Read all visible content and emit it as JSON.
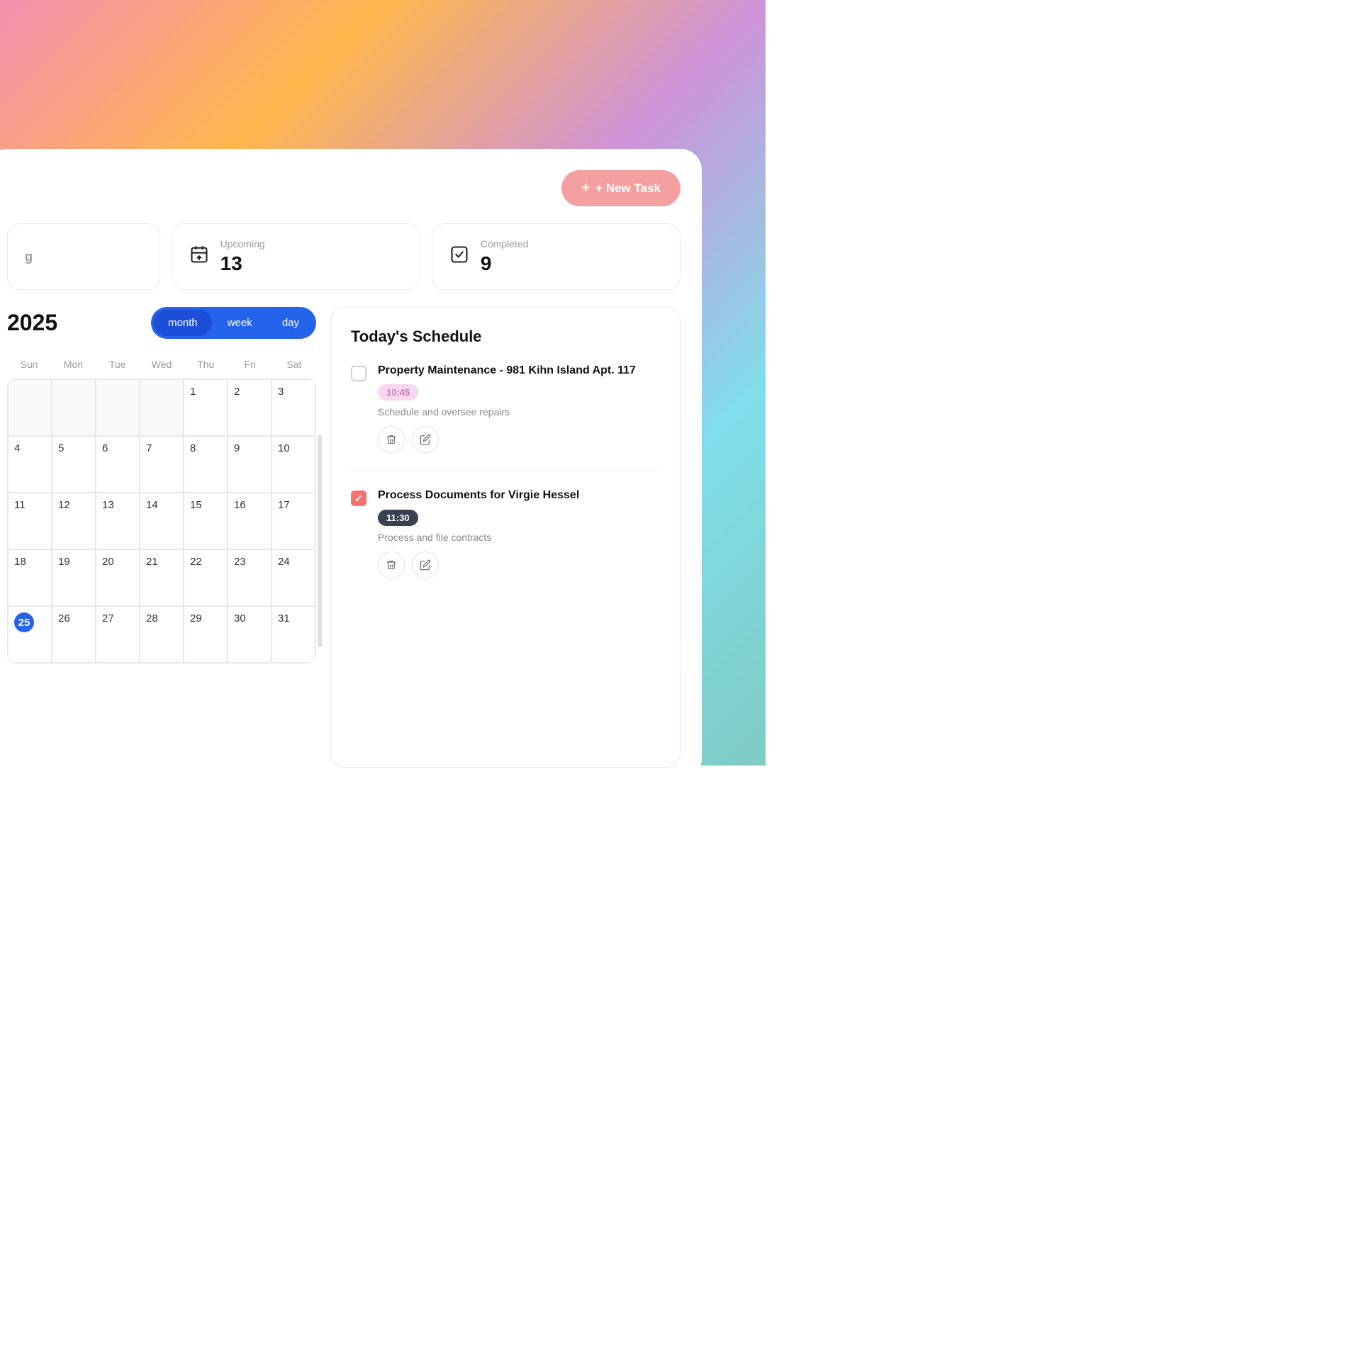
{
  "background": {
    "gradient": "pink to teal"
  },
  "header": {
    "new_task_label": "+ New Task"
  },
  "stats": {
    "partial_label": "g",
    "upcoming_label": "Upcoming",
    "upcoming_value": "13",
    "completed_label": "Completed",
    "completed_value": "9"
  },
  "calendar": {
    "year_label": "2025",
    "view_toggle": {
      "month_label": "month",
      "week_label": "week",
      "day_label": "day",
      "active": "month"
    },
    "day_headers": [
      "Sun",
      "Mon",
      "Tue",
      "Wed",
      "Thu",
      "Fri",
      "Sat"
    ],
    "weeks": [
      [
        null,
        null,
        null,
        null,
        "1",
        "2",
        "3",
        "4"
      ],
      [
        "5",
        "6",
        "7",
        "8",
        "9",
        "10",
        "11"
      ],
      [
        "12",
        "13",
        "14",
        "15",
        "16",
        "17",
        "18"
      ],
      [
        "19",
        "20",
        "21",
        "22",
        "23",
        "24",
        "25"
      ],
      [
        "26",
        "27",
        "28",
        "29",
        "30",
        "31",
        null
      ]
    ],
    "today": "25"
  },
  "schedule": {
    "title": "Today's Schedule",
    "tasks": [
      {
        "id": 1,
        "title": "Property Maintenance - 981 Kihn Island Apt. 117",
        "time": "10:45",
        "time_style": "pink",
        "description": "Schedule and oversee repairs",
        "checked": false
      },
      {
        "id": 2,
        "title": "Process Documents for Virgie Hessel",
        "time": "11:30",
        "time_style": "dark",
        "description": "Process and file contracts",
        "checked": true
      }
    ]
  },
  "icons": {
    "plus": "+",
    "upcoming_icon": "📅",
    "completed_icon": "✓",
    "delete_icon": "🗑",
    "edit_icon": "✏"
  }
}
